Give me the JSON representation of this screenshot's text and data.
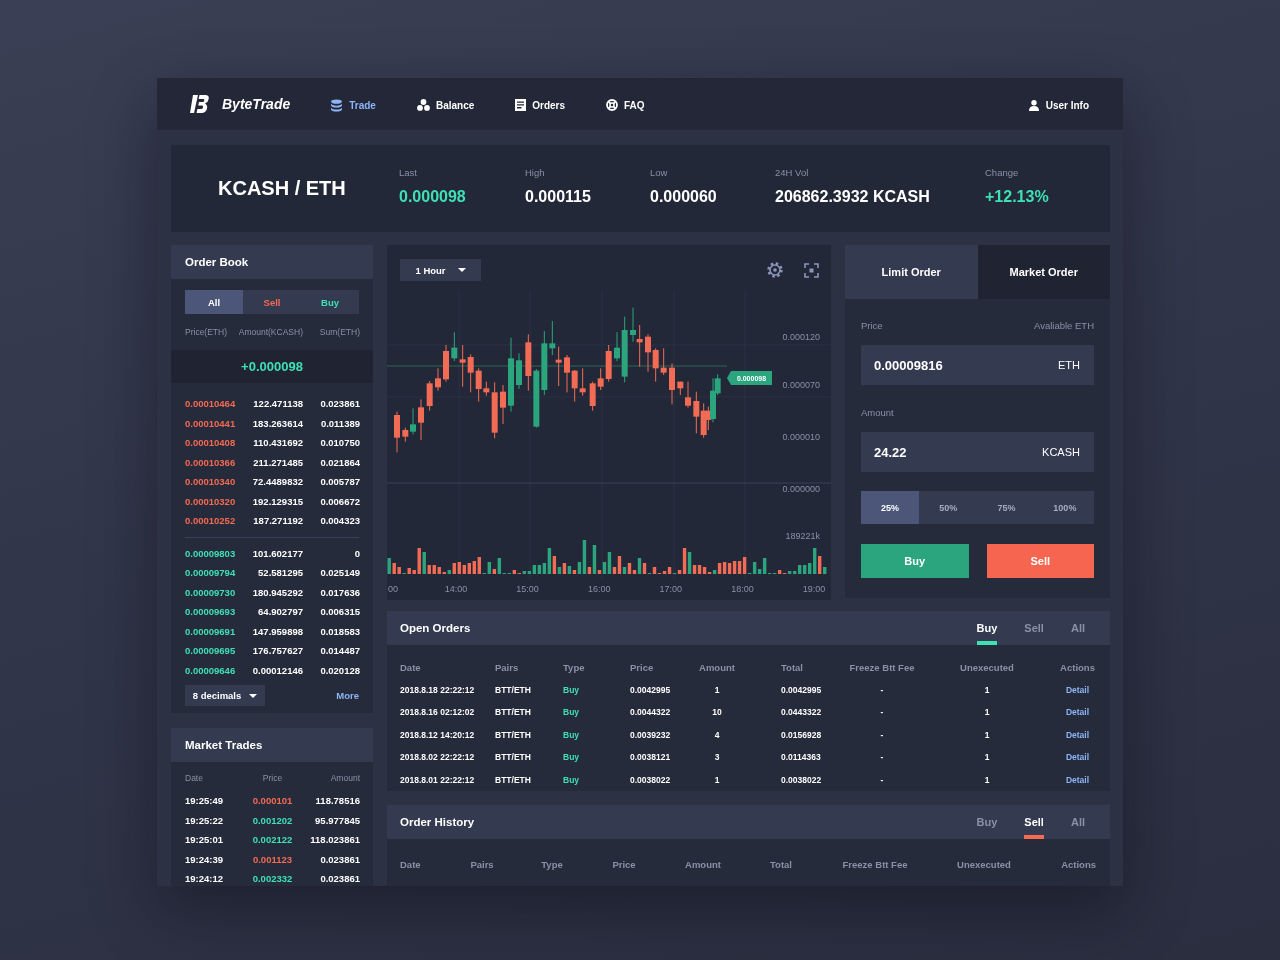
{
  "nav": {
    "brand": "ByteTrade",
    "items": [
      {
        "label": "Trade",
        "selected": true
      },
      {
        "label": "Balance",
        "selected": false
      },
      {
        "label": "Orders",
        "selected": false
      },
      {
        "label": "FAQ",
        "selected": false
      }
    ],
    "user": "User Info"
  },
  "ticker": {
    "pair": "KCASH / ETH",
    "stats": [
      {
        "label": "Last",
        "value": "0.000098",
        "kind": "up"
      },
      {
        "label": "High",
        "value": "0.000115",
        "kind": "plain"
      },
      {
        "label": "Low",
        "value": "0.000060",
        "kind": "plain"
      },
      {
        "label": "24H Vol",
        "value": "206862.3932 KCASH",
        "kind": "plain"
      },
      {
        "label": "Change",
        "value": "+12.13%",
        "kind": "up"
      }
    ]
  },
  "order_book": {
    "title": "Order Book",
    "tabs": [
      {
        "label": "All",
        "kind": "all",
        "selected": true
      },
      {
        "label": "Sell",
        "kind": "sell",
        "selected": false
      },
      {
        "label": "Buy",
        "kind": "buy",
        "selected": false
      }
    ],
    "columns": [
      "Price(ETH)",
      "Amount(KCASH)",
      "Sum(ETH)"
    ],
    "mid_price": "+0.000098",
    "asks": [
      {
        "price": "0.00010464",
        "amount": "122.471138",
        "sum": "0.023861"
      },
      {
        "price": "0.00010441",
        "amount": "183.263614",
        "sum": "0.011389"
      },
      {
        "price": "0.00010408",
        "amount": "110.431692",
        "sum": "0.010750"
      },
      {
        "price": "0.00010366",
        "amount": "211.271485",
        "sum": "0.021864"
      },
      {
        "price": "0.00010340",
        "amount": "72.4489832",
        "sum": "0.005787"
      },
      {
        "price": "0.00010320",
        "amount": "192.129315",
        "sum": "0.006672"
      },
      {
        "price": "0.00010252",
        "amount": "187.271192",
        "sum": "0.004323"
      }
    ],
    "bids": [
      {
        "price": "0.00009803",
        "amount": "101.602177",
        "sum": "0"
      },
      {
        "price": "0.00009794",
        "amount": "52.581295",
        "sum": "0.025149"
      },
      {
        "price": "0.00009730",
        "amount": "180.945292",
        "sum": "0.017636"
      },
      {
        "price": "0.00009693",
        "amount": "64.902797",
        "sum": "0.006315"
      },
      {
        "price": "0.00009691",
        "amount": "147.959898",
        "sum": "0.018583"
      },
      {
        "price": "0.00009695",
        "amount": "176.757627",
        "sum": "0.014487"
      },
      {
        "price": "0.00009646",
        "amount": "0.00012146",
        "sum": "0.020128"
      }
    ],
    "decimals": "8 decimals",
    "more": "More"
  },
  "market_trades": {
    "title": "Market Trades",
    "columns": [
      "Date",
      "Price",
      "Amount"
    ],
    "rows": [
      {
        "time": "19:25:49",
        "price": "0.000101",
        "amount": "118.78516",
        "kind": "sell"
      },
      {
        "time": "19:25:22",
        "price": "0.001202",
        "amount": "95.977845",
        "kind": "buy"
      },
      {
        "time": "19:25:01",
        "price": "0.002122",
        "amount": "118.023861",
        "kind": "buy"
      },
      {
        "time": "19:24:39",
        "price": "0.001123",
        "amount": "0.023861",
        "kind": "sell"
      },
      {
        "time": "19:24:12",
        "price": "0.002332",
        "amount": "0.023861",
        "kind": "buy"
      }
    ]
  },
  "chart": {
    "interval": "1 Hour",
    "price_labels": [
      "0.000120",
      "0.000070",
      "0.000010",
      "0.000000"
    ],
    "last_price": "0.000098",
    "volume_label": "189221k",
    "time_labels": [
      "00",
      "14:00",
      "15:00",
      "16:00",
      "17:00",
      "18:00",
      "19:00"
    ]
  },
  "order_form": {
    "tabs": [
      {
        "label": "Limit Order",
        "selected": true
      },
      {
        "label": "Market Order",
        "selected": false
      }
    ],
    "price": {
      "label": "Price",
      "hint": "Avaliable ETH",
      "value": "0.00009816",
      "unit": "ETH"
    },
    "amount": {
      "label": "Amount",
      "value": "24.22",
      "unit": "KCASH"
    },
    "percentages": [
      {
        "label": "25%",
        "selected": true
      },
      {
        "label": "50%",
        "selected": false
      },
      {
        "label": "75%",
        "selected": false
      },
      {
        "label": "100%",
        "selected": false
      }
    ],
    "buttons": [
      {
        "label": "Buy",
        "kind": "buy"
      },
      {
        "label": "Sell",
        "kind": "sell"
      }
    ]
  },
  "open_orders": {
    "title": "Open Orders",
    "tabs": [
      {
        "label": "Buy",
        "kind": "buy",
        "selected": true
      },
      {
        "label": "Sell",
        "kind": "sell",
        "selected": false
      },
      {
        "label": "All",
        "kind": "all",
        "selected": false
      }
    ],
    "columns": [
      "Date",
      "Pairs",
      "Type",
      "Price",
      "Amount",
      "Total",
      "Freeze Btt Fee",
      "Unexecuted",
      "Actions"
    ],
    "rows": [
      {
        "date": "2018.8.18 22:22:12",
        "pair": "BTT/ETH",
        "type": "Buy",
        "price": "0.0042995",
        "amount": "1",
        "total": "0.0042995",
        "fee": "-",
        "unexecuted": "1",
        "action": "Detail"
      },
      {
        "date": "2018.8.16 02:12:02",
        "pair": "BTT/ETH",
        "type": "Buy",
        "price": "0.0044322",
        "amount": "10",
        "total": "0.0443322",
        "fee": "-",
        "unexecuted": "1",
        "action": "Detail"
      },
      {
        "date": "2018.8.12 14:20:12",
        "pair": "BTT/ETH",
        "type": "Buy",
        "price": "0.0039232",
        "amount": "4",
        "total": "0.0156928",
        "fee": "-",
        "unexecuted": "1",
        "action": "Detail"
      },
      {
        "date": "2018.8.02 22:22:12",
        "pair": "BTT/ETH",
        "type": "Buy",
        "price": "0.0038121",
        "amount": "3",
        "total": "0.0114363",
        "fee": "-",
        "unexecuted": "1",
        "action": "Detail"
      },
      {
        "date": "2018.8.01 22:22:12",
        "pair": "BTT/ETH",
        "type": "Buy",
        "price": "0.0038022",
        "amount": "1",
        "total": "0.0038022",
        "fee": "-",
        "unexecuted": "1",
        "action": "Detail"
      }
    ]
  },
  "order_history": {
    "title": "Order History",
    "tabs": [
      {
        "label": "Buy",
        "kind": "buy",
        "selected": false
      },
      {
        "label": "Sell",
        "kind": "sell",
        "selected": true
      },
      {
        "label": "All",
        "kind": "all",
        "selected": false
      }
    ],
    "columns": [
      "Date",
      "Pairs",
      "Type",
      "Price",
      "Amount",
      "Total",
      "Freeze Btt Fee",
      "Unexecuted",
      "Actions"
    ]
  }
}
